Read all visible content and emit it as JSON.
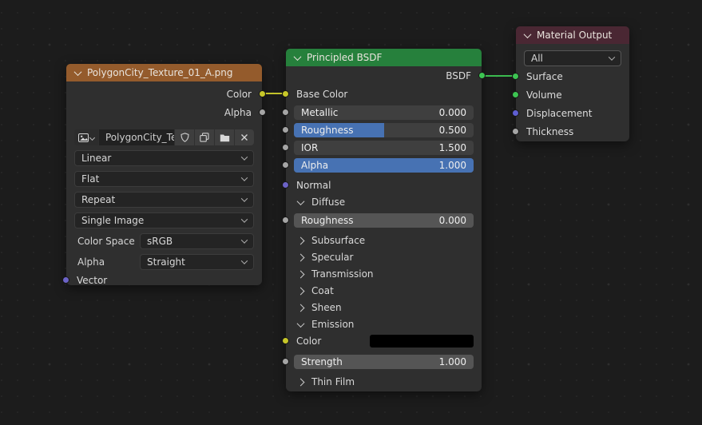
{
  "colors": {
    "background": "#1c1c1c",
    "node_body": "#2f2f2f",
    "texture_header": "#945b2c",
    "shader_header": "#26803c",
    "output_header": "#4a2733",
    "slider_blue": "#4772b3",
    "slider_dark": "#3f3f3f",
    "slider_gray": "#555555",
    "socket_yellow": "#c7c729",
    "socket_gray": "#a5a5a5",
    "socket_vector": "#6c63c7",
    "socket_displacement": "#5f5fd3",
    "socket_shader": "#3dc452",
    "wire_yellow": "#c2c22a",
    "wire_green": "#3bba4f",
    "swatch_black": "#000000"
  },
  "texture_node": {
    "title": "PolygonCity_Texture_01_A.png",
    "outputs": [
      {
        "label": "Color"
      },
      {
        "label": "Alpha"
      }
    ],
    "image_name": "PolygonCity_Te...",
    "interpolation": "Linear",
    "projection": "Flat",
    "extension": "Repeat",
    "source": "Single Image",
    "color_space": {
      "label": "Color Space",
      "value": "sRGB"
    },
    "alpha_mode": {
      "label": "Alpha",
      "value": "Straight"
    },
    "inputs": [
      {
        "label": "Vector"
      }
    ]
  },
  "bsdf_node": {
    "title": "Principled BSDF",
    "output_label": "BSDF",
    "base_color_label": "Base Color",
    "sliders": [
      {
        "label": "Metallic",
        "value": "0.000",
        "fill": 0
      },
      {
        "label": "Roughness",
        "value": "0.500",
        "fill": 0.5
      },
      {
        "label": "IOR",
        "value": "1.500",
        "fill": 0
      },
      {
        "label": "Alpha",
        "value": "1.000",
        "fill": 1
      }
    ],
    "normal_label": "Normal",
    "panels": {
      "diffuse": "Diffuse",
      "subsurface": "Subsurface",
      "specular": "Specular",
      "transmission": "Transmission",
      "coat": "Coat",
      "sheen": "Sheen",
      "emission": "Emission",
      "thin_film": "Thin Film"
    },
    "diffuse_roughness": {
      "label": "Roughness",
      "value": "0.000"
    },
    "emission_color_label": "Color",
    "emission_strength": {
      "label": "Strength",
      "value": "1.000"
    }
  },
  "output_node": {
    "title": "Material Output",
    "target": "All",
    "inputs": [
      {
        "label": "Surface"
      },
      {
        "label": "Volume"
      },
      {
        "label": "Displacement"
      },
      {
        "label": "Thickness"
      }
    ]
  }
}
